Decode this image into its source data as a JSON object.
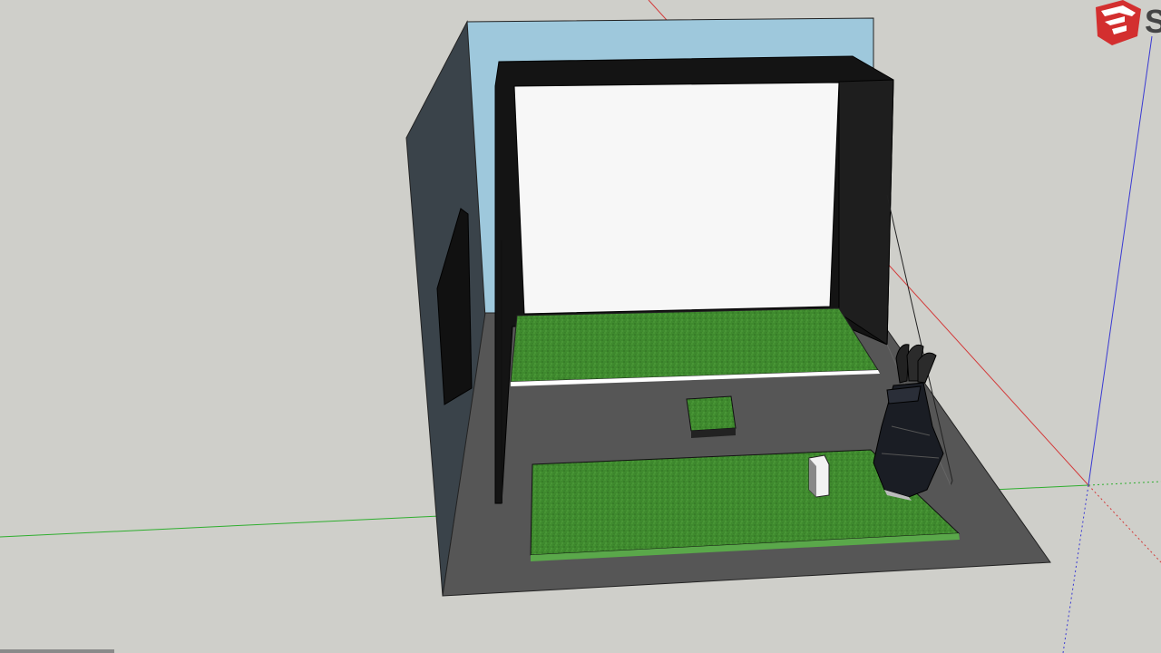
{
  "app": {
    "logo_icon": "sketchup-logo-icon",
    "logo_text": "S",
    "logo_color": "#d32f2f"
  },
  "colors": {
    "background": "#cfcfca",
    "x_axis": "#d33a3a",
    "y_axis": "#2fae2f",
    "z_axis": "#3a3ad3",
    "screen": "#f7f7f7",
    "enclosure_frame": "#141414",
    "back_wall": "#9ec8dc",
    "side_wall": "#3a434a",
    "floor": "#565656",
    "turf": "#3f8a2e"
  },
  "scene": {
    "objects": [
      "back-wall",
      "left-side-wall",
      "floor",
      "impact-screen",
      "screen-enclosure",
      "front-turf",
      "hitting-mat",
      "tee-box",
      "launch-monitor",
      "golf-bag",
      "wall-tv",
      "side-net"
    ]
  }
}
